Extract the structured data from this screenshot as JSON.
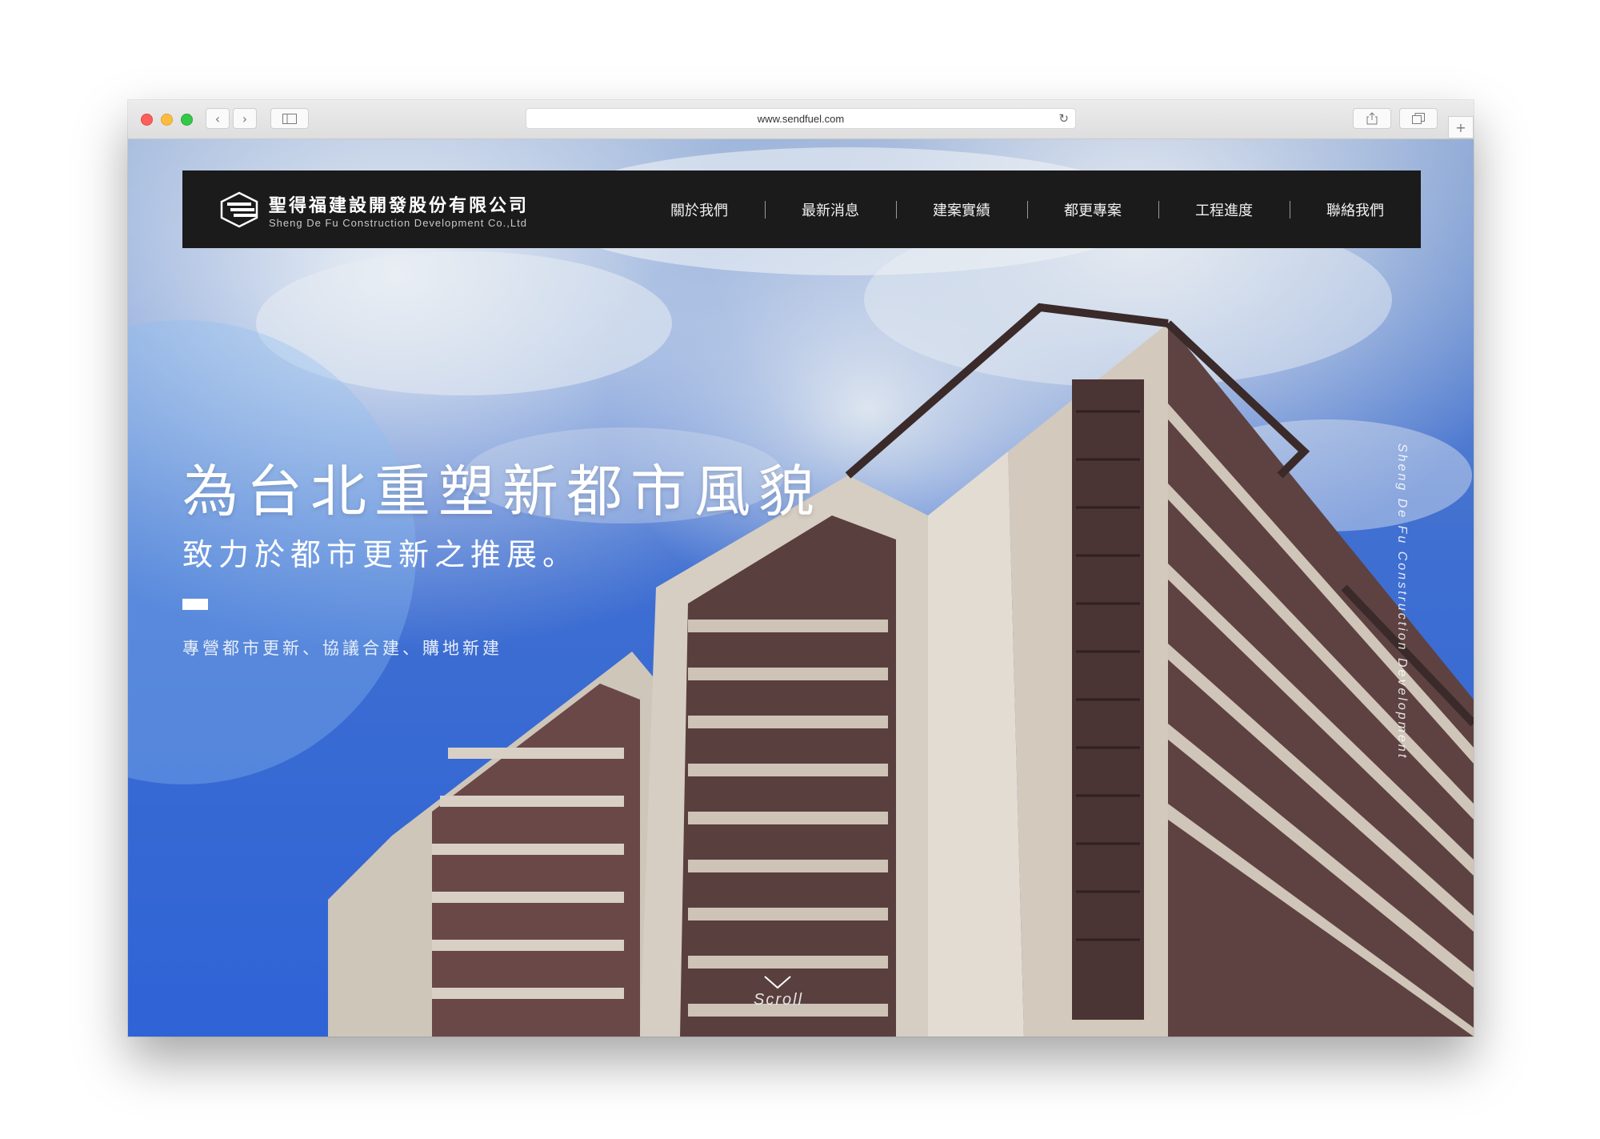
{
  "browser": {
    "url": "www.sendfuel.com"
  },
  "nav": {
    "brand_zh": "聖得福建設開發股份有限公司",
    "brand_en": "Sheng De Fu Construction Development Co.,Ltd",
    "items": [
      {
        "label": "關於我們"
      },
      {
        "label": "最新消息"
      },
      {
        "label": "建案實績"
      },
      {
        "label": "都更專案"
      },
      {
        "label": "工程進度"
      },
      {
        "label": "聯絡我們"
      }
    ]
  },
  "hero": {
    "headline": "為台北重塑新都市風貌",
    "subline": "致力於都市更新之推展。",
    "services": "專營都市更新、協議合建、購地新建",
    "vertical_text": "Sheng De Fu Construction Development",
    "scroll_label": "Scroll"
  },
  "colors": {
    "nav_bg": "#1b1b1b",
    "sky": "#2f63d6",
    "building_dark": "#5a3f3f",
    "building_light": "#d9d2c8"
  }
}
